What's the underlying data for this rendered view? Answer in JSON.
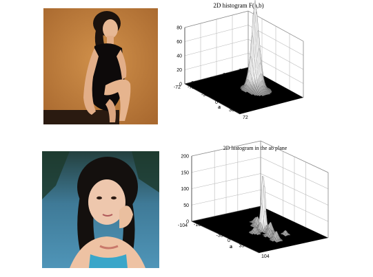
{
  "chart_data": [
    {
      "type": "surface",
      "title": "2D histogram F(a,b)",
      "xlabel": "a",
      "ylabel": "b",
      "zlabel": "",
      "a_ticks": [
        -72,
        -36,
        0,
        36,
        72
      ],
      "b_ticks": [
        -72,
        -36,
        0,
        36,
        72
      ],
      "z_ticks": [
        0,
        20,
        40,
        60,
        80
      ],
      "a_range": [
        -72,
        72
      ],
      "b_range": [
        -72,
        72
      ],
      "z_range": [
        0,
        80
      ],
      "grid": true,
      "floor_color": "#000000",
      "peaks": [
        {
          "a": 4,
          "b": 20,
          "height": 62,
          "spread": 4
        },
        {
          "a": 8,
          "b": 24,
          "height": 48,
          "spread": 5
        },
        {
          "a": 0,
          "b": 16,
          "height": 34,
          "spread": 6
        },
        {
          "a": 12,
          "b": 22,
          "height": 26,
          "spread": 8
        }
      ]
    },
    {
      "type": "surface",
      "title": "2D histogram  in the ab plane",
      "xlabel": "a",
      "ylabel": "b",
      "zlabel": "",
      "a_ticks": [
        -104,
        -35,
        0,
        35,
        104
      ],
      "b_ticks": [
        -104,
        -35,
        0,
        35,
        104
      ],
      "z_ticks": [
        0,
        50,
        100,
        150,
        200
      ],
      "a_range": [
        -104,
        104
      ],
      "b_range": [
        -104,
        104
      ],
      "z_range": [
        0,
        200
      ],
      "grid": true,
      "floor_color": "#000000",
      "peaks": [
        {
          "a": 4,
          "b": 6,
          "height": 120,
          "spread": 4
        },
        {
          "a": 6,
          "b": 4,
          "height": 70,
          "spread": 5
        },
        {
          "a": -18,
          "b": 10,
          "height": 30,
          "spread": 5
        },
        {
          "a": 26,
          "b": 6,
          "height": 35,
          "spread": 5
        },
        {
          "a": 38,
          "b": -8,
          "height": 25,
          "spread": 5
        },
        {
          "a": 62,
          "b": -12,
          "height": 28,
          "spread": 5
        },
        {
          "a": 10,
          "b": -24,
          "height": 18,
          "spread": 5
        },
        {
          "a": -34,
          "b": 22,
          "height": 18,
          "spread": 5
        },
        {
          "a": 48,
          "b": 30,
          "height": 14,
          "spread": 4
        }
      ]
    }
  ],
  "photos": [
    {
      "name": "woman-seated-photo",
      "bg": "#c0803f"
    },
    {
      "name": "woman-portrait-photo",
      "bg": "#3c6f8e"
    }
  ]
}
